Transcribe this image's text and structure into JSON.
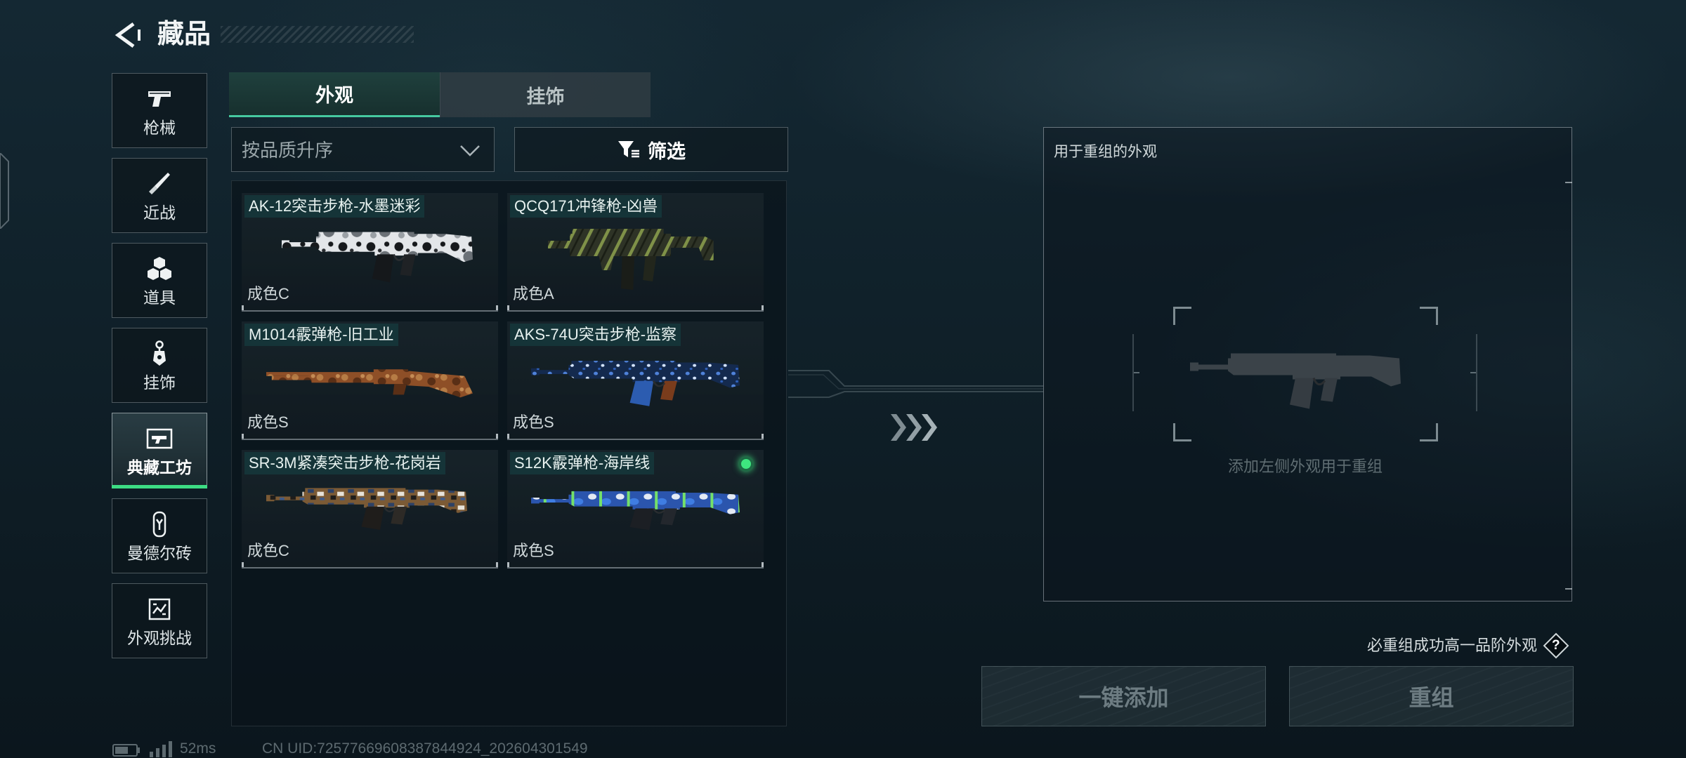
{
  "header": {
    "title": "藏品",
    "back_icon": "back-arrow-icon"
  },
  "sidebar": {
    "items": [
      {
        "label": "枪械",
        "icon": "pistol-icon",
        "selected": false
      },
      {
        "label": "近战",
        "icon": "knife-icon",
        "selected": false
      },
      {
        "label": "道具",
        "icon": "cubes-icon",
        "selected": false
      },
      {
        "label": "挂饰",
        "icon": "keychain-icon",
        "selected": false
      },
      {
        "label": "典藏工坊",
        "icon": "workshop-frame-icon",
        "selected": true
      },
      {
        "label": "曼德尔砖",
        "icon": "mandel-brick-icon",
        "selected": false
      },
      {
        "label": "外观挑战",
        "icon": "skin-challenge-icon",
        "selected": false
      }
    ]
  },
  "tabs": [
    {
      "label": "外观",
      "active": true
    },
    {
      "label": "挂饰",
      "active": false
    }
  ],
  "sort": {
    "selected": "按品质升序",
    "icon": "chevron-down-icon"
  },
  "filter": {
    "label": "筛选",
    "icon": "filter-icon"
  },
  "items": [
    {
      "name": "AK-12突击步枪-水墨迷彩",
      "grade": "成色C",
      "marked": false
    },
    {
      "name": "QCQ171冲锋枪-凶兽",
      "grade": "成色A",
      "marked": false
    },
    {
      "name": "M1014霰弹枪-旧工业",
      "grade": "成色S",
      "marked": false
    },
    {
      "name": "AKS-74U突击步枪-监察",
      "grade": "成色S",
      "marked": false
    },
    {
      "name": "SR-3M紧凑突击步枪-花岗岩",
      "grade": "成色C",
      "marked": false
    },
    {
      "name": "S12K霰弹枪-海岸线",
      "grade": "成色S",
      "marked": true
    }
  ],
  "reforge": {
    "title": "用于重组的外观",
    "hint": "添加左侧外观用于重组",
    "note": "必重组成功高一品阶外观",
    "help_label": "?"
  },
  "actions": {
    "add_all": "一键添加",
    "reforge": "重组"
  },
  "status": {
    "ping": "52ms",
    "uid": "CN UID:72577669608387844924_202604301549"
  },
  "colors": {
    "accent_green": "#3ddc84",
    "tab_active_underline": "#46c9a0",
    "background": "#10212a",
    "disabled_text": "#6d7c82"
  }
}
